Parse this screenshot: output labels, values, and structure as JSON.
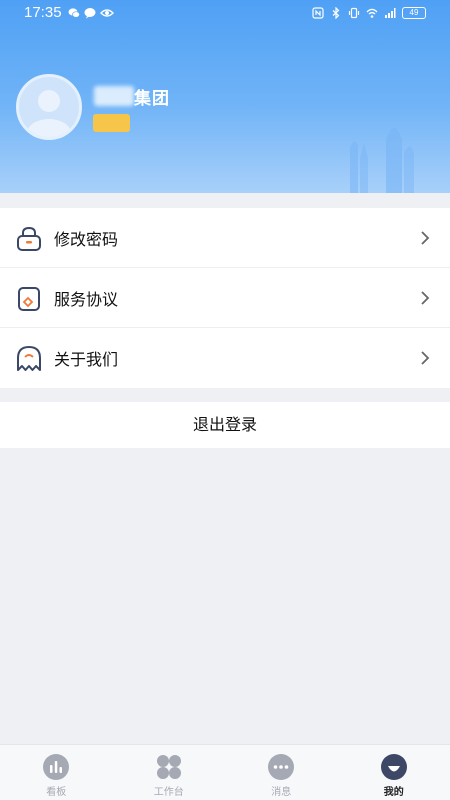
{
  "status_bar": {
    "time": "17:35",
    "battery": "49"
  },
  "profile": {
    "company_name": "集团",
    "role_badge": "",
    "avatar_icon": "user-avatar-icon"
  },
  "menu": {
    "items": [
      {
        "label": "修改密码",
        "icon": "lock-icon"
      },
      {
        "label": "服务协议",
        "icon": "document-icon"
      },
      {
        "label": "关于我们",
        "icon": "ghost-icon"
      }
    ]
  },
  "logout_label": "退出登录",
  "tabbar": {
    "tabs": [
      {
        "label": "看板",
        "icon": "chart-icon",
        "active": false
      },
      {
        "label": "工作台",
        "icon": "grid-icon",
        "active": false
      },
      {
        "label": "消息",
        "icon": "message-icon",
        "active": false
      },
      {
        "label": "我的",
        "icon": "profile-icon",
        "active": true
      }
    ]
  },
  "colors": {
    "header_top": "#4fa0f5",
    "header_bottom": "#a8d0fa",
    "badge": "#f5c64a",
    "icon_stroke": "#3a4766",
    "icon_accent": "#f07a3a",
    "tab_inactive": "#a5a9b3",
    "tab_active": "#3d4766"
  }
}
